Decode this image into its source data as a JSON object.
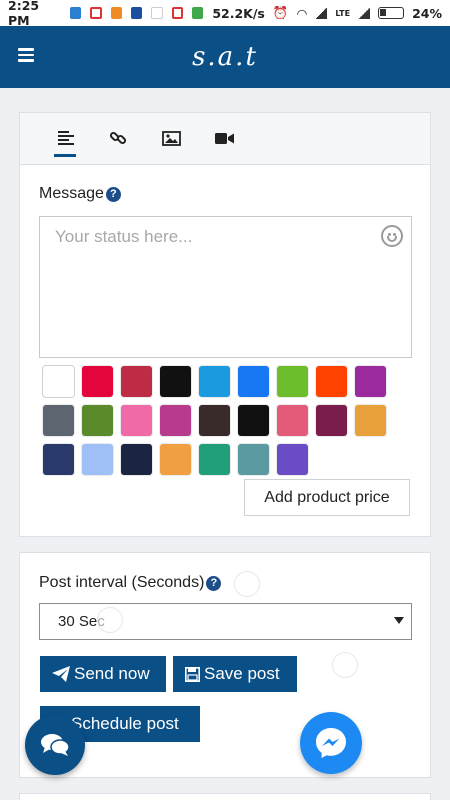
{
  "status_bar": {
    "time": "2:25 PM",
    "speed": "52.2K/s",
    "network": "LTE",
    "battery": "24%",
    "notification_icons": [
      "info-icon",
      "gmail-icon",
      "vpn-icon",
      "paypal-icon",
      "dot-icon",
      "gmail-icon",
      "android-icon"
    ]
  },
  "app_bar": {
    "menu_icon": "hamburger-icon",
    "title": "s.a.t"
  },
  "composer": {
    "tabs": [
      {
        "name": "text",
        "icon": "text-align-icon",
        "active": true
      },
      {
        "name": "link",
        "icon": "link-icon",
        "active": false
      },
      {
        "name": "image",
        "icon": "image-icon",
        "active": false
      },
      {
        "name": "video",
        "icon": "video-camera-icon",
        "active": false
      }
    ],
    "message_label": "Message",
    "message_placeholder": "Your status here...",
    "background_swatches": [
      "#ffffff",
      "#e4053d",
      "#bd2b45",
      "#111111",
      "#1b9ae0",
      "#1877f2",
      "#6dbe2d",
      "#ff4200",
      "#9b2a9e",
      "#5d6670",
      "#5a8a29",
      "#f06aa8",
      "#b83a8c",
      "#3a2b2b",
      "#111111",
      "#e35b78",
      "#7b1d4c",
      "#e8a03a",
      "#2a3a6a",
      "#9ec0f7",
      "#1b2440",
      "#f0a040",
      "#209f7a",
      "#5a9aa0",
      "#6a4cc7"
    ],
    "add_price_label": "Add product price"
  },
  "post_settings": {
    "interval_label": "Post interval (Seconds)",
    "interval_value": "30 Sec",
    "send_now_label": "Send now",
    "save_post_label": "Save post",
    "schedule_post_label": "Schedule post"
  },
  "floating": {
    "chat_icon": "chat-bubbles-icon",
    "messenger_icon": "messenger-icon"
  },
  "colors": {
    "primary": "#0b4f87",
    "messenger": "#1d8af4"
  }
}
